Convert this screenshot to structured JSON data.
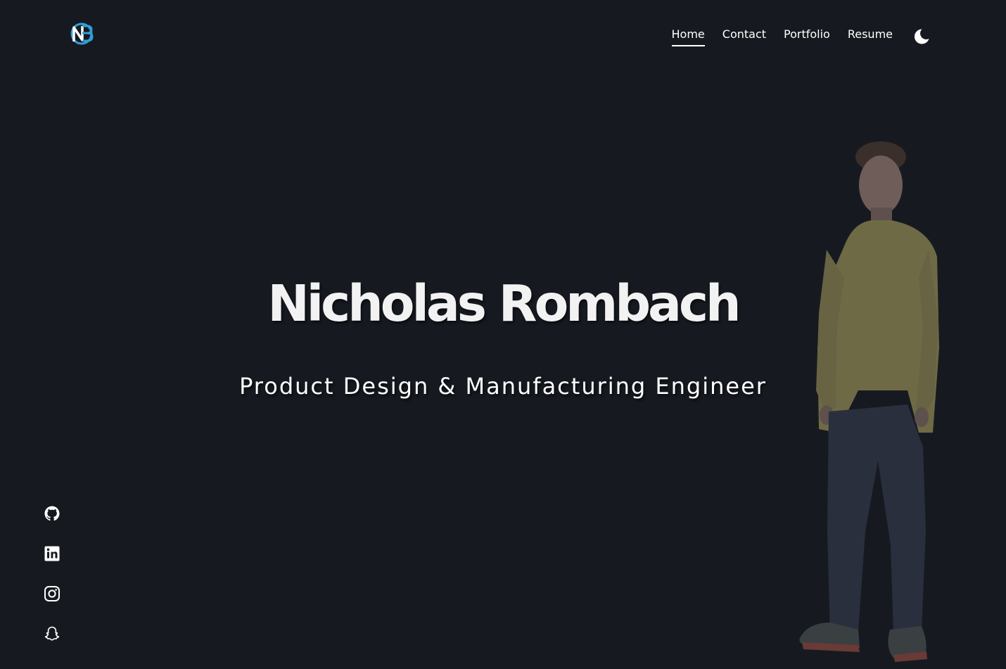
{
  "header": {
    "logo_alt": "NB",
    "nav": [
      {
        "label": "Home",
        "active": true
      },
      {
        "label": "Contact",
        "active": false
      },
      {
        "label": "Portfolio",
        "active": false
      },
      {
        "label": "Resume",
        "active": false
      }
    ],
    "theme_toggle_icon": "moon-icon"
  },
  "hero": {
    "name": "Nicholas Rombach",
    "title": "Product Design & Manufacturing Engineer"
  },
  "socials": [
    {
      "icon": "github-icon"
    },
    {
      "icon": "linkedin-icon"
    },
    {
      "icon": "instagram-icon"
    },
    {
      "icon": "snapchat-icon"
    }
  ],
  "colors": {
    "background": "#161a20",
    "text": "#ffffff",
    "logo_blue": "#2f9fd8"
  }
}
